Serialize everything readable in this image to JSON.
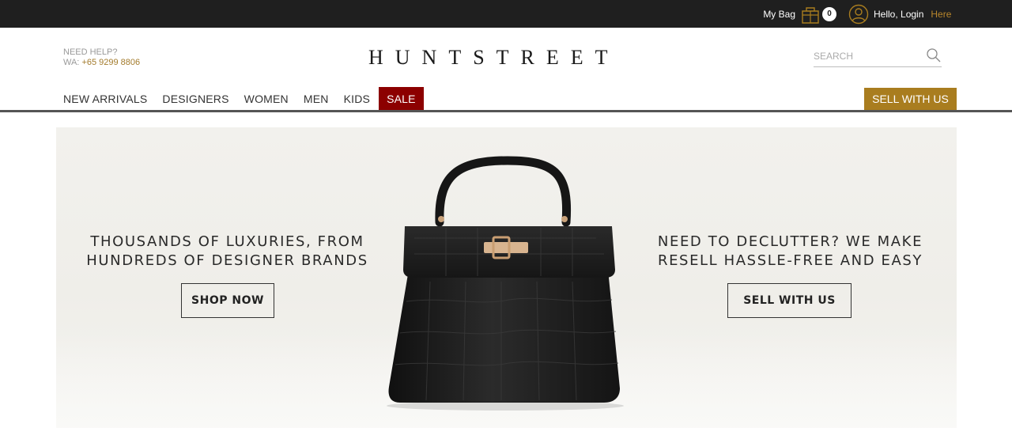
{
  "topbar": {
    "bag_label": "My Bag",
    "bag_count": "0",
    "hello": "Hello, Login",
    "here": "Here"
  },
  "header": {
    "help_title": "NEED HELP?",
    "wa_prefix": "WA: ",
    "wa_number": "+65 9299 8806",
    "logo": "HUNTSTREET",
    "search_placeholder": "SEARCH"
  },
  "nav": {
    "items": [
      "NEW ARRIVALS",
      "DESIGNERS",
      "WOMEN",
      "MEN",
      "KIDS",
      "SALE"
    ],
    "sell_button": "SELL WITH US"
  },
  "hero": {
    "left_line1": "THOUSANDS OF LUXURIES, FROM",
    "left_line2": "HUNDREDS OF DESIGNER BRANDS",
    "shop_button": "SHOP NOW",
    "right_line1": "NEED TO DECLUTTER? WE MAKE",
    "right_line2": "RESELL HASSLE-FREE AND EASY",
    "sell_button": "SELL WITH US"
  },
  "colors": {
    "topbar_bg": "#1f1f1f",
    "accent_gold": "#a97d1f",
    "sale_red": "#8c0000",
    "hero_bg": "#f2f1ed"
  },
  "icons": {
    "bag": "shopping-bag-icon",
    "user": "user-circle-icon",
    "search": "search-icon"
  }
}
